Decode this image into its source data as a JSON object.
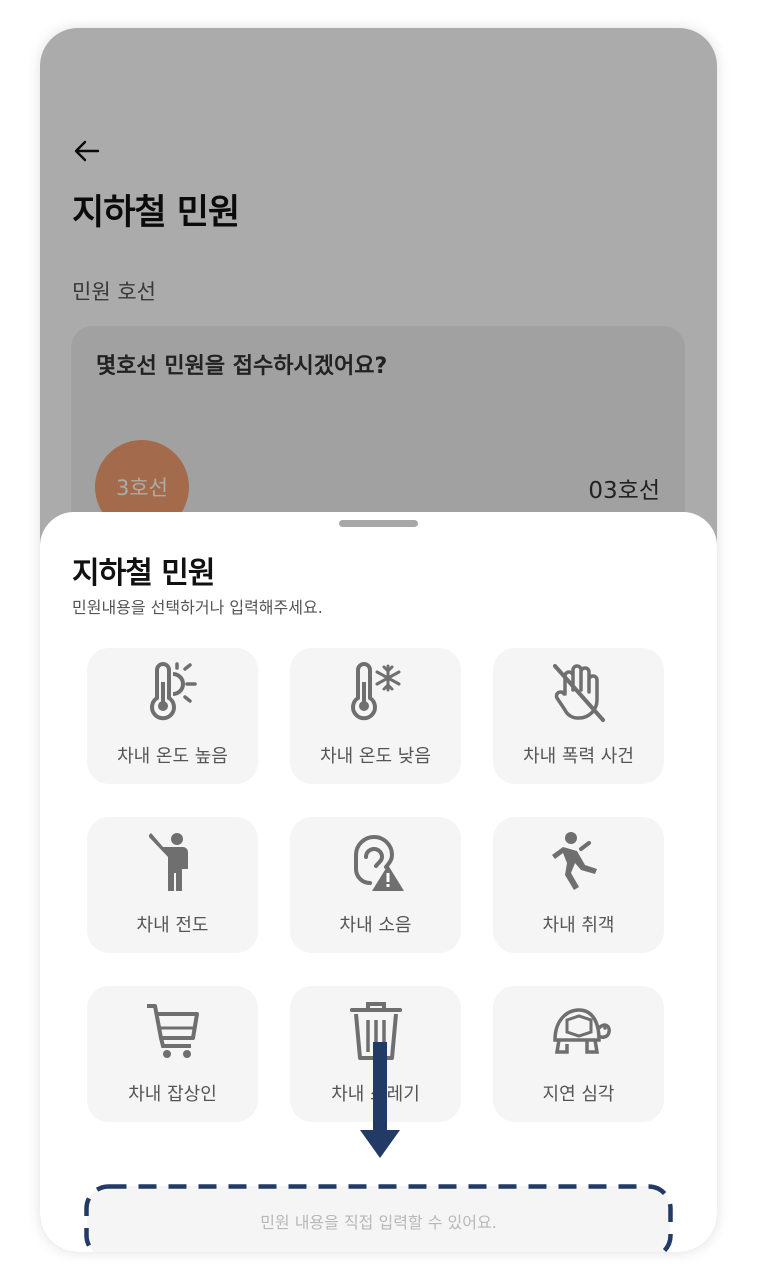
{
  "page": {
    "title": "지하철 민원",
    "line_section_label": "민원 호선",
    "line_question": "몇호선 민원을 접수하시겠어요?",
    "line_badge": "3호선",
    "line_value": "03호선"
  },
  "sheet": {
    "title": "지하철 민원",
    "subtitle": "민원내용을 선택하거나 입력해주세요.",
    "items": [
      {
        "label": "차내 온도 높음",
        "icon": "thermometer-hot-icon"
      },
      {
        "label": "차내 온도 낮음",
        "icon": "thermometer-cold-icon"
      },
      {
        "label": "차내 폭력 사건",
        "icon": "violence-hand-icon"
      },
      {
        "label": "차내 전도",
        "icon": "person-fall-icon"
      },
      {
        "label": "차내 소음",
        "icon": "noise-warning-icon"
      },
      {
        "label": "차내 취객",
        "icon": "drunk-person-icon"
      },
      {
        "label": "차내 잡상인",
        "icon": "cart-icon"
      },
      {
        "label": "차내 쓰레기",
        "icon": "trash-icon"
      },
      {
        "label": "지연 심각",
        "icon": "turtle-icon"
      }
    ],
    "input_placeholder": "민원 내용을 직접 입력할 수 있어요."
  },
  "colors": {
    "accent": "#f4a070",
    "annotation": "#223a66",
    "icon": "#6f6f6f"
  }
}
